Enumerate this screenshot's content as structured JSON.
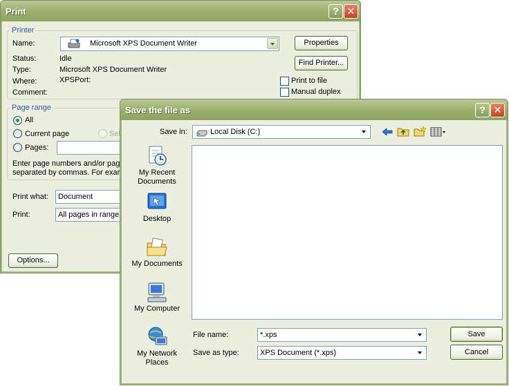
{
  "print_dialog": {
    "title": "Print",
    "help_button": "?",
    "close_button": "✕",
    "printer_group": "Printer",
    "name_label": "Name:",
    "printer_name": "Microsoft XPS Document Writer",
    "status_label": "Status:",
    "status_value": "Idle",
    "type_label": "Type:",
    "type_value": "Microsoft XPS Document Writer",
    "where_label": "Where:",
    "where_value": "XPSPort:",
    "comment_label": "Comment:",
    "comment_value": "",
    "properties_button": "Properties",
    "find_printer_button": "Find Printer...",
    "print_to_file_label": "Print to file",
    "manual_duplex_label": "Manual duplex",
    "page_range_group": "Page range",
    "all_label": "All",
    "current_page_label": "Current page",
    "selection_label": "Sel",
    "pages_label": "Pages:",
    "pages_value": "",
    "help_text_line1": "Enter page numbers and/or page",
    "help_text_line2": "separated by commas.  For exar",
    "print_what_label": "Print what:",
    "print_what_value": "Document",
    "print_label": "Print:",
    "print_value": "All pages in range",
    "options_button": "Options..."
  },
  "save_dialog": {
    "title": "Save the file as",
    "help_button": "?",
    "close_button": "✕",
    "save_in_label": "Save in:",
    "save_in_value": "Local Disk (C:)",
    "places": [
      {
        "label": "My Recent Documents",
        "icon": "recent-documents-icon"
      },
      {
        "label": "Desktop",
        "icon": "desktop-icon"
      },
      {
        "label": "My Documents",
        "icon": "my-documents-icon"
      },
      {
        "label": "My Computer",
        "icon": "my-computer-icon"
      },
      {
        "label": "My Network Places",
        "icon": "network-places-icon"
      }
    ],
    "file_name_label": "File name:",
    "file_name_value": "*.xps",
    "save_as_type_label": "Save as type:",
    "save_as_type_value": "XPS Document (*.xps)",
    "save_button": "Save",
    "cancel_button": "Cancel"
  },
  "colors": {
    "titlebar": "#9aae6c",
    "dialog_bg": "#eceedf",
    "group_title": "#315a9e",
    "radio_dot": "#21a121"
  }
}
